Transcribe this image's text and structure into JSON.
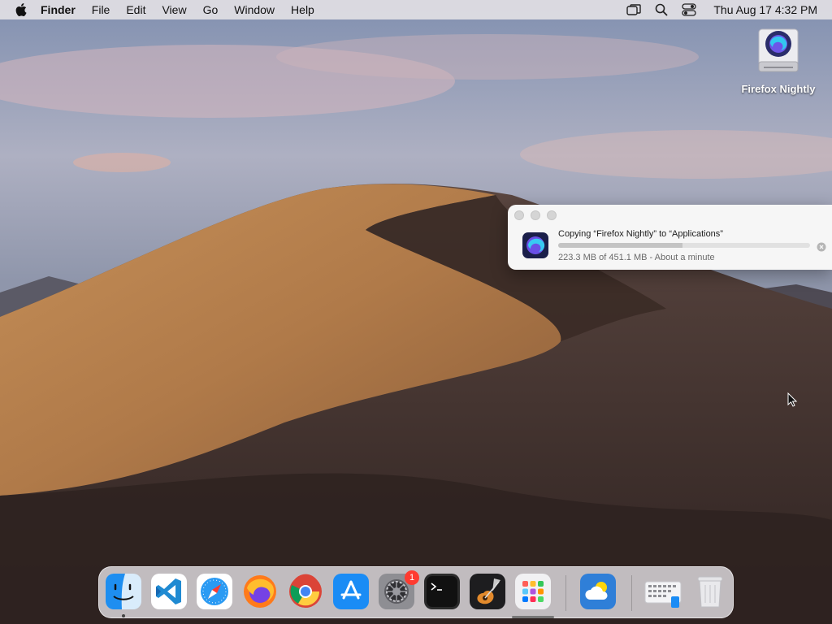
{
  "menubar": {
    "app_name": "Finder",
    "menus": [
      "File",
      "Edit",
      "View",
      "Go",
      "Window",
      "Help"
    ],
    "clock": "Thu Aug 17  4:32 PM",
    "status_icons": [
      "window-icon",
      "search-icon",
      "control-center-icon"
    ]
  },
  "desktop": {
    "wallpaper": "desert-dunes",
    "icon_label": "Firefox Nightly",
    "icon": "disk-image-icon"
  },
  "copy_dialog": {
    "title": "Copying “Firefox Nightly” to “Applications”",
    "status": "223.3 MB of 451.1 MB - About a minute",
    "progress": 0.495,
    "app_icon": "firefox-nightly-icon"
  },
  "dock": {
    "apps": [
      {
        "name": "Finder",
        "icon": "finder-icon",
        "running": true
      },
      {
        "name": "Visual Studio Code",
        "icon": "vscode-icon"
      },
      {
        "name": "Safari",
        "icon": "safari-icon"
      },
      {
        "name": "Firefox",
        "icon": "firefox-icon"
      },
      {
        "name": "Google Chrome",
        "icon": "chrome-icon"
      },
      {
        "name": "App Store",
        "icon": "app-store-icon"
      },
      {
        "name": "System Settings",
        "icon": "settings-icon",
        "badge": "1"
      },
      {
        "name": "Terminal",
        "icon": "terminal-icon"
      },
      {
        "name": "GarageBand",
        "icon": "garageband-icon"
      },
      {
        "name": "Launchpad",
        "icon": "launchpad-icon"
      },
      {
        "name": "Weather",
        "icon": "weather-icon"
      },
      {
        "name": "Downloads",
        "icon": "downloads-stack-icon"
      },
      {
        "name": "Trash",
        "icon": "trash-icon"
      }
    ]
  },
  "colors": {
    "badge": "#ff3b30",
    "progress_fill": "#c4c4c4",
    "menubar_bg": "#e2dfe4"
  }
}
